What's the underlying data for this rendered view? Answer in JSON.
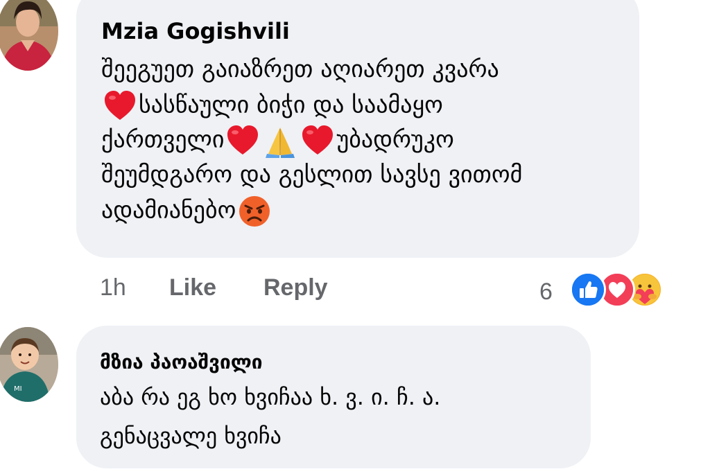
{
  "comments": [
    {
      "author": "Mzia Gogishvili",
      "lines": [
        {
          "parts": [
            "შეეგუეთ გაიაზრეთ აღიარეთ კვარა"
          ]
        },
        {
          "parts": [
            "",
            "სასწაული ბიჭი და საამაყო"
          ]
        },
        {
          "parts": [
            "ქართველი",
            "",
            "უბადრუკო"
          ]
        },
        {
          "parts": [
            "შეუმდგარო და გესლით სავსე ვითომ"
          ]
        },
        {
          "parts": [
            "ადამიანებო",
            ""
          ]
        }
      ],
      "time": "1h",
      "like_label": "Like",
      "reply_label": "Reply",
      "reaction_count": "6",
      "reactions": [
        "like-icon",
        "love-icon",
        "care-icon"
      ],
      "emojis": [
        "red-heart",
        "red-heart",
        "folded-hands",
        "red-heart",
        "angry-face"
      ]
    },
    {
      "author": "მზია პაოაშვილი",
      "lines": [
        {
          "parts": [
            "აბა რა ეგ ხო ხვიჩაა ხ. ვ. ი. ჩ.  ა."
          ]
        },
        {
          "parts": [
            "გენაცვალე ხვიჩა"
          ]
        }
      ]
    }
  ],
  "colors": {
    "bubble": "#eff1f5",
    "secondary_text": "#65676b",
    "like_blue": "#1877f2",
    "love_red": "#f33e58",
    "care_yellow": "#f7b125"
  }
}
